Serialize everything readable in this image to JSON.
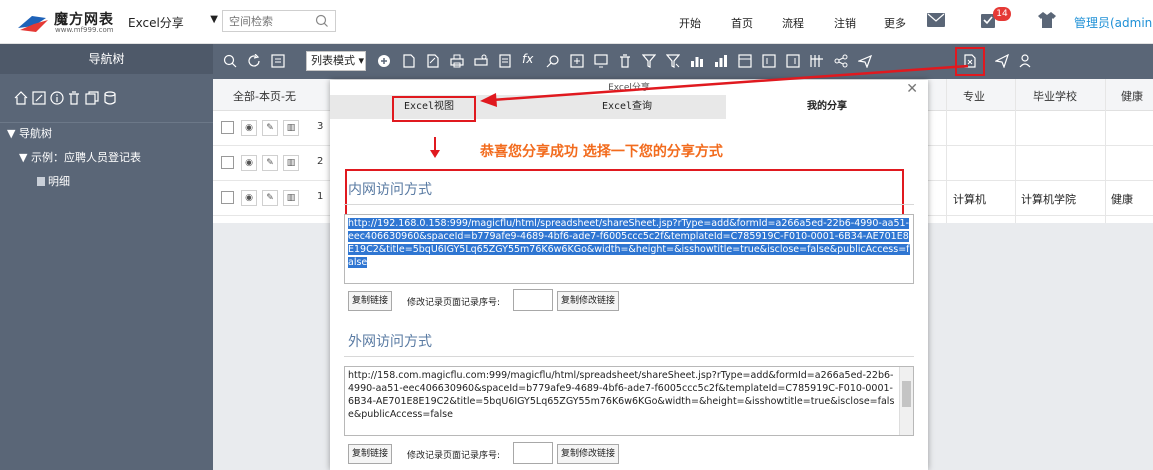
{
  "topbar": {
    "logo_title": "魔方网表",
    "logo_sub": "www.mf999.com",
    "app_select": "Excel分享",
    "search_placeholder": "空间检索",
    "nav": [
      {
        "label": "开始"
      },
      {
        "label": "首页"
      },
      {
        "label": "流程"
      },
      {
        "label": "注销"
      },
      {
        "label": "更多"
      }
    ],
    "notification_count": "14",
    "user": "管理员(admin)"
  },
  "sidebar": {
    "title": "导航树",
    "tree": [
      {
        "label": "▼ 导航树"
      },
      {
        "label": "▼ 示例：应聘人员登记表"
      },
      {
        "label": "明细"
      }
    ]
  },
  "toolbar": {
    "view_mode": "列表模式 ▾"
  },
  "grid": {
    "header_first": "全部-本页-无",
    "columns": [
      {
        "label": "专业"
      },
      {
        "label": "毕业学校"
      },
      {
        "label": "健康"
      }
    ],
    "rows": [
      {
        "num": "3",
        "major": "",
        "school": "",
        "health": ""
      },
      {
        "num": "2",
        "major": "",
        "school": "",
        "health": ""
      },
      {
        "num": "1",
        "major": "计算机",
        "school": "计算机学院",
        "health": "健康"
      }
    ]
  },
  "modal": {
    "title": "Excel分享",
    "tabs": [
      {
        "label": "Excel视图"
      },
      {
        "label": "Excel查询"
      },
      {
        "label": "我的分享"
      }
    ],
    "success_message": "恭喜您分享成功 选择一下您的分享方式",
    "intranet": {
      "title": "内网访问方式",
      "url": "http://192.168.0.158:999/magicflu/html/spreadsheet/shareSheet.jsp?rType=add&formId=a266a5ed-22b6-4990-aa51-eec406630960&spaceId=b779afe9-4689-4bf6-ade7-f6005ccc5c2f&templateId=C785919C-F010-0001-6B34-AE701E8E19C2&title=5bqU6IGY5Lq65ZGY55m76K6w6KGo&width=&height=&isshowtitle=true&isclose=false&publicAccess=false",
      "copy_button": "复制链接",
      "record_label": "修改记录页面记录序号:",
      "copy_modify_button": "复制修改链接"
    },
    "internet": {
      "title": "外网访问方式",
      "url": "http://158.com.magicflu.com:999/magicflu/html/spreadsheet/shareSheet.jsp?rType=add&formId=a266a5ed-22b6-4990-aa51-eec406630960&spaceId=b779afe9-4689-4bf6-ade7-f6005ccc5c2f&templateId=C785919C-F010-0001-6B34-AE701E8E19C2&title=5bqU6IGY5Lq65ZGY55m76K6w6KGo&width=&height=&isshowtitle=true&isclose=false&publicAccess=false",
      "copy_button": "复制链接",
      "record_label": "修改记录页面记录序号:",
      "copy_modify_button": "复制修改链接"
    }
  },
  "colors": {
    "sidebar_bg": "#5a6677",
    "highlight_red": "#e0191f",
    "success_orange": "#f26b1d",
    "link_blue": "#1e90d6",
    "selection_blue": "#2f76d2"
  }
}
